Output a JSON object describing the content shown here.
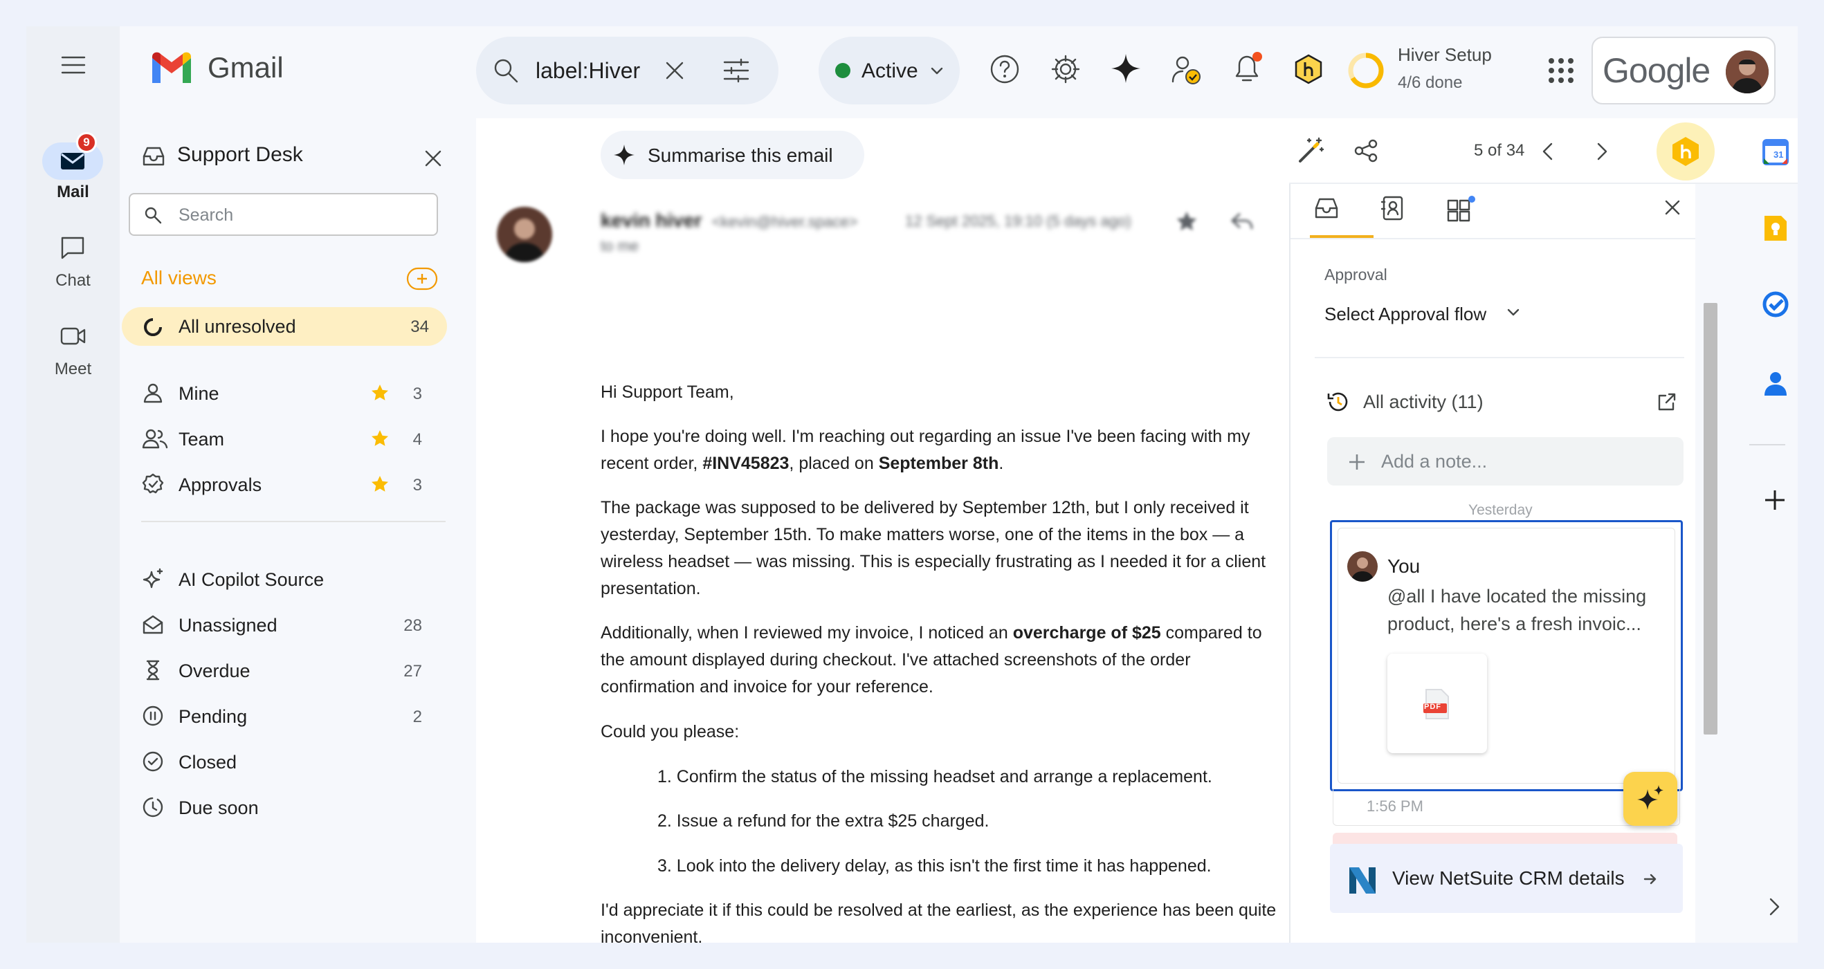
{
  "rail": {
    "mail_label": "Mail",
    "mail_badge": "9",
    "chat_label": "Chat",
    "meet_label": "Meet"
  },
  "header": {
    "app_name": "Gmail",
    "search_value": "label:Hiver",
    "status_label": "Active",
    "setup_title": "Hiver Setup",
    "setup_progress_text": "4/6 done",
    "setup_progress": 0.667,
    "brand": "Google"
  },
  "sidebar": {
    "title": "Support Desk",
    "search_placeholder": "Search",
    "views_label": "All views",
    "all_unresolved": {
      "label": "All unresolved",
      "count": "34"
    },
    "group1": [
      {
        "label": "Mine",
        "count": "3"
      },
      {
        "label": "Team",
        "count": "4"
      },
      {
        "label": "Approvals",
        "count": "3"
      }
    ],
    "group2": [
      {
        "label": "AI Copilot Source",
        "count": ""
      },
      {
        "label": "Unassigned",
        "count": "28"
      },
      {
        "label": "Overdue",
        "count": "27"
      },
      {
        "label": "Pending",
        "count": "2"
      },
      {
        "label": "Closed",
        "count": ""
      },
      {
        "label": "Due soon",
        "count": ""
      }
    ]
  },
  "toolbar": {
    "pager": "5 of 34"
  },
  "email": {
    "summarise_label": "Summarise this email",
    "sender_name": "kevin hiver",
    "sender_email": "<kevin@hiver.space>",
    "date": "12 Sept 2025, 19:10 (5 days ago)",
    "to": "to me",
    "greeting": "Hi Support Team,",
    "p1_a": "I hope you're doing well. I'm reaching out regarding an issue I've been facing with my",
    "p1_b": "recent order, ",
    "p1_order": "#INV45823",
    "p1_c": ", placed on ",
    "p1_date": "September 8th",
    "p1_d": ".",
    "p2_l1": "The package was supposed to be delivered by September 12th, but I only received it",
    "p2_l2": "yesterday, September 15th. To make matters worse, one of the items in the box — a",
    "p2_l3": "wireless headset — was missing. This is especially frustrating as I needed it for a client",
    "p2_l4": "presentation.",
    "p3_a": "Additionally, when I reviewed my invoice, I noticed an ",
    "p3_bold": "overcharge of $25",
    "p3_b": " compared to",
    "p3_l2": "the amount displayed during checkout. I've attached screenshots of the order",
    "p3_l3": "confirmation and invoice for your reference.",
    "ask": "Could you please:",
    "items": [
      "1. Confirm the status of the missing headset and arrange a replacement.",
      "2. Issue a refund for the extra $25 charged.",
      "3. Look into the delivery delay, as this isn't the first time it has happened."
    ],
    "closing_l1": "I'd appreciate it if this could be resolved at the earliest, as the experience has been quite",
    "closing_l2": "inconvenient."
  },
  "panel": {
    "approval_label": "Approval",
    "approval_select": "Select Approval flow",
    "activity_label": "All activity",
    "activity_count": "(11)",
    "note_placeholder": "Add a note...",
    "day_label": "Yesterday",
    "note_author": "You",
    "note_text_l1": "@all I have located the missing",
    "note_text_l2": "product, here's a fresh invoic...",
    "attachment_type": "PDF",
    "note_time": "1:56 PM",
    "crm_label": "View NetSuite CRM details"
  },
  "colors": {
    "accent_orange": "#f29900",
    "active_green": "#1e8e3e",
    "selected_row": "#feefc3",
    "note_border": "#1a56c9",
    "hiver_yellow": "#fbd34c"
  }
}
